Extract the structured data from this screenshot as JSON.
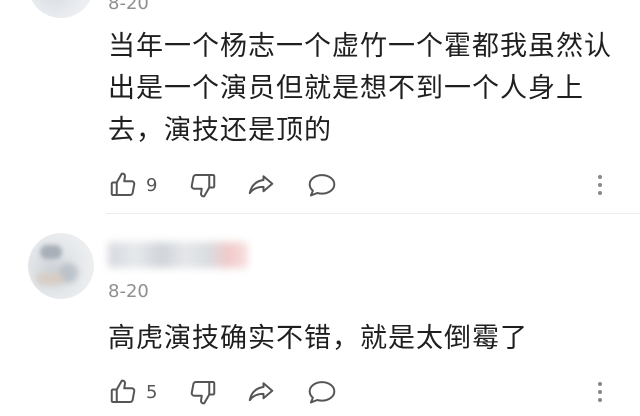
{
  "comments": [
    {
      "timestamp": "8-20",
      "text": "当年一个杨志一个虚竹一个霍都我虽然认出是一个演员但就是想不到一个人身上去，演技还是顶的",
      "like_count": "9",
      "icons": {
        "like": "thumbs-up-icon",
        "dislike": "thumbs-down-icon",
        "share": "share-icon",
        "reply": "comment-bubble-icon",
        "more": "more-vertical-icon"
      }
    },
    {
      "timestamp": "8-20",
      "text": "高虎演技确实不错，就是太倒霉了",
      "like_count": "5",
      "icons": {
        "like": "thumbs-up-icon",
        "dislike": "thumbs-down-icon",
        "share": "share-icon",
        "reply": "comment-bubble-icon",
        "more": "more-vertical-icon"
      }
    }
  ],
  "colors": {
    "text": "#1f1f1f",
    "muted": "#8f8f8f",
    "icon": "#555555",
    "divider": "#ececec"
  }
}
